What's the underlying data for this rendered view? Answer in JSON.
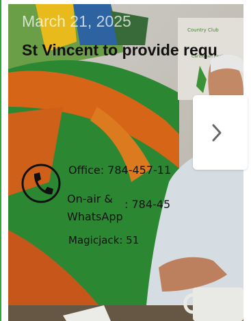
{
  "article": {
    "date": "March 21, 2025",
    "headline": "St Vincent to provide requ"
  },
  "photo_text": {
    "office": "Office: 784-457-11",
    "onair_line1": "On-air &",
    "onair_line2": "WhatsApp",
    "onair_number": ": 784-45",
    "magicjack": "Magicjack: 51"
  },
  "carousel": {
    "next_glyph": "›"
  },
  "colors": {
    "accent_green": "#2ea63a",
    "headline": "#111111",
    "date": "#ffffff"
  },
  "icons": {
    "next": "chevron-right-icon",
    "phone": "phone-icon"
  }
}
